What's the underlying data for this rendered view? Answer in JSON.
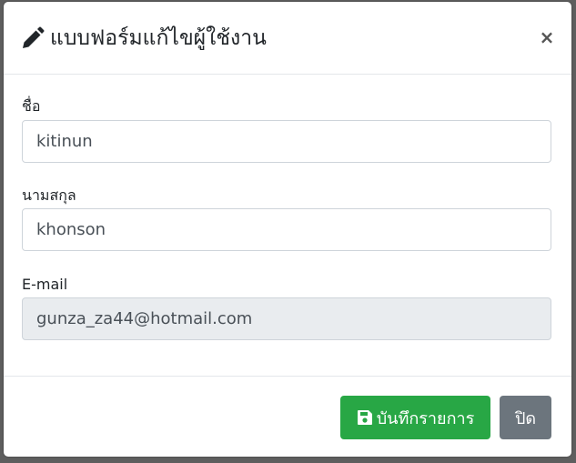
{
  "dialog": {
    "title": "แบบฟอร์มแก้ไขผู้ใช้งาน",
    "title_icon": "pencil-icon",
    "close_symbol": "×"
  },
  "form": {
    "first_name": {
      "label": "ชื่อ",
      "value": "kitinun"
    },
    "last_name": {
      "label": "นามสกุล",
      "value": "khonson"
    },
    "email": {
      "label": "E-mail",
      "value": "gunza_za44@hotmail.com",
      "readonly": true
    }
  },
  "footer": {
    "save_label": "บันทึกรายการ",
    "save_icon": "floppy-disk-icon",
    "close_label": "ปิด"
  },
  "colors": {
    "save_button": "#28a745",
    "close_button": "#6c757d",
    "readonly_field": "#e9ecef"
  }
}
